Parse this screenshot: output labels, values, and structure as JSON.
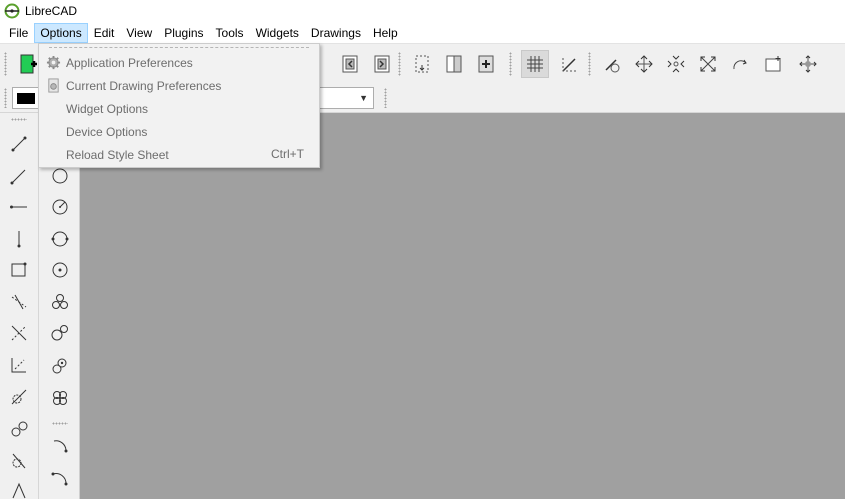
{
  "window": {
    "title": "LibreCAD"
  },
  "menubar": {
    "items": [
      {
        "label": "File",
        "name": "menu-file"
      },
      {
        "label": "Options",
        "name": "menu-options"
      },
      {
        "label": "Edit",
        "name": "menu-edit"
      },
      {
        "label": "View",
        "name": "menu-view"
      },
      {
        "label": "Plugins",
        "name": "menu-plugins"
      },
      {
        "label": "Tools",
        "name": "menu-tools"
      },
      {
        "label": "Widgets",
        "name": "menu-widgets"
      },
      {
        "label": "Drawings",
        "name": "menu-drawings"
      },
      {
        "label": "Help",
        "name": "menu-help"
      }
    ],
    "active": "Options"
  },
  "options_menu": {
    "items": [
      {
        "label": "Application Preferences",
        "shortcut": "",
        "icon": "gear-icon"
      },
      {
        "label": "Current Drawing Preferences",
        "shortcut": "",
        "icon": "document-settings-icon"
      },
      {
        "label": "Widget Options",
        "shortcut": "",
        "icon": ""
      },
      {
        "label": "Device Options",
        "shortcut": "",
        "icon": ""
      },
      {
        "label": "Reload Style Sheet",
        "shortcut": "Ctrl+T",
        "icon": ""
      }
    ]
  },
  "toolbar": {
    "pen_color": "#000000",
    "canvas_color": "#a0a0a0",
    "grid_toggle_pressed": true
  }
}
